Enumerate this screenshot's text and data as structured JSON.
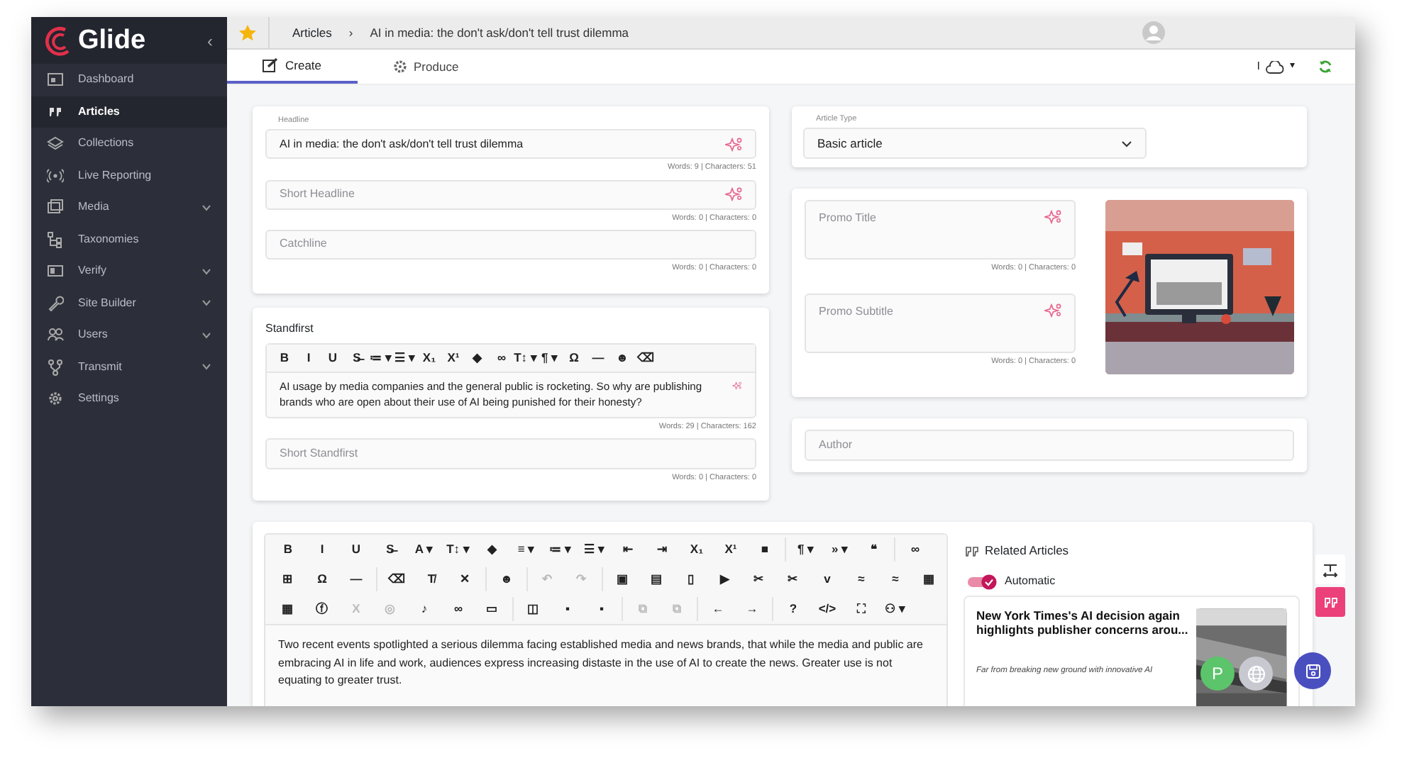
{
  "sidebar": {
    "logo": "Glide",
    "collapse": "‹",
    "items": [
      {
        "label": "Dashboard",
        "selected": false,
        "kind": "link"
      },
      {
        "label": "Articles",
        "selected": true,
        "kind": "link"
      },
      {
        "label": "Collections",
        "selected": false,
        "kind": "link"
      },
      {
        "label": "Live Reporting",
        "selected": false,
        "kind": "link"
      },
      {
        "label": "Media",
        "selected": false,
        "kind": "menu"
      },
      {
        "label": "Taxonomies",
        "selected": false,
        "kind": "link"
      },
      {
        "label": "Verify",
        "selected": false,
        "kind": "menu"
      },
      {
        "label": "Site Builder",
        "selected": false,
        "kind": "menu"
      },
      {
        "label": "Users",
        "selected": false,
        "kind": "menu"
      },
      {
        "label": "Transmit",
        "selected": false,
        "kind": "menu"
      },
      {
        "label": "Settings",
        "selected": false,
        "kind": "link"
      }
    ]
  },
  "breadcrumb": [
    "Articles",
    "AI in media: the don't ask/don't tell trust dilemma"
  ],
  "breadcrumb_separator": "›",
  "tabs": [
    {
      "label": "Create",
      "selected": true
    },
    {
      "label": "Produce",
      "selected": false
    }
  ],
  "status": {
    "cursor": "I",
    "caret": "▾"
  },
  "headline_card": {
    "fields": [
      {
        "label": "Headline",
        "value": "AI in media: the don't ask/don't tell trust dilemma",
        "counter": "Words: 9 | Characters: 51",
        "ai": true
      },
      {
        "placeholder": "Short Headline",
        "counter": "Words: 0 | Characters: 0",
        "ai": true
      },
      {
        "placeholder": "Catchline",
        "counter": "Words: 0 | Characters: 0",
        "ai": false
      }
    ]
  },
  "standfirst_card": {
    "title": "Standfirst",
    "toolbar": [
      "B",
      "I",
      "U",
      "S̶",
      "≔ ▾",
      "☰ ▾",
      "X₁",
      "X¹",
      "◆",
      "∞",
      "T↕ ▾",
      "¶ ▾",
      "Ω",
      "—",
      "☻",
      "⌫"
    ],
    "text": "AI usage by media companies and the general public is rocketing. So why are publishing brands who are open about their use of AI being punished for their honesty?",
    "counter": "Words: 29 | Characters: 162",
    "short": {
      "placeholder": "Short Standfirst",
      "counter": "Words: 0 | Characters: 0"
    }
  },
  "article_type": {
    "label": "Article Type",
    "value": "Basic article"
  },
  "promo": {
    "fields": [
      {
        "placeholder": "Promo Title",
        "counter": "Words: 0 | Characters: 0"
      },
      {
        "placeholder": "Promo Subtitle",
        "counter": "Words: 0 | Characters: 0"
      }
    ]
  },
  "author": {
    "placeholder": "Author"
  },
  "editor": {
    "toolbar": [
      [
        [
          {
            "t": "B",
            "disabled": false
          },
          {
            "t": "I",
            "disabled": false
          },
          {
            "t": "U",
            "disabled": false
          },
          {
            "t": "S̶",
            "disabled": false
          },
          {
            "t": "A ▾",
            "disabled": false
          },
          {
            "t": "T↕ ▾",
            "disabled": false
          },
          {
            "t": "◆",
            "disabled": false
          },
          {
            "t": "≡ ▾",
            "disabled": false
          },
          {
            "t": "≔ ▾",
            "disabled": false
          },
          {
            "t": "☰ ▾",
            "disabled": false
          },
          {
            "t": "⇤",
            "disabled": false
          },
          {
            "t": "⇥",
            "disabled": false
          },
          {
            "t": "X₁",
            "disabled": false
          },
          {
            "t": "X¹",
            "disabled": false
          },
          {
            "t": "■",
            "disabled": false
          }
        ],
        [
          {
            "t": "¶ ▾",
            "disabled": false
          },
          {
            "t": "» ▾",
            "disabled": false
          },
          {
            "t": "❝",
            "disabled": false
          }
        ],
        [
          {
            "t": "∞",
            "disabled": false
          }
        ]
      ],
      [
        [
          {
            "t": "⊞",
            "disabled": false
          },
          {
            "t": "Ω",
            "disabled": false
          },
          {
            "t": "—",
            "disabled": false
          }
        ],
        [
          {
            "t": "⌫",
            "disabled": false
          },
          {
            "t": "T̸",
            "disabled": false
          },
          {
            "t": "✕",
            "disabled": false
          }
        ],
        [
          {
            "t": "☻",
            "disabled": false
          }
        ],
        [
          {
            "t": "↶",
            "disabled": true
          },
          {
            "t": "↷",
            "disabled": true
          }
        ],
        [
          {
            "t": "▣",
            "disabled": false
          },
          {
            "t": "▤",
            "disabled": false
          },
          {
            "t": "▯",
            "disabled": false
          },
          {
            "t": "▶",
            "disabled": false
          },
          {
            "t": "✂",
            "disabled": false
          },
          {
            "t": "✂",
            "disabled": false
          },
          {
            "t": "v",
            "disabled": false
          },
          {
            "t": "≈",
            "disabled": false
          },
          {
            "t": "≈",
            "disabled": false
          },
          {
            "t": "▦",
            "disabled": false
          }
        ]
      ],
      [
        [
          {
            "t": "▦",
            "disabled": false
          },
          {
            "t": "ⓕ",
            "disabled": false
          },
          {
            "t": "X",
            "disabled": true
          },
          {
            "t": "◎",
            "disabled": true
          },
          {
            "t": "♪",
            "disabled": false
          },
          {
            "t": "∞",
            "disabled": false
          },
          {
            "t": "▭",
            "disabled": false
          }
        ],
        [
          {
            "t": "◫",
            "disabled": false
          },
          {
            "t": "▪",
            "disabled": false
          },
          {
            "t": "▪",
            "disabled": false
          }
        ],
        [
          {
            "t": "⧉",
            "disabled": true
          },
          {
            "t": "⧉",
            "disabled": true
          }
        ],
        [
          {
            "t": "←",
            "disabled": false
          },
          {
            "t": "→",
            "disabled": false
          }
        ],
        [
          {
            "t": "?",
            "disabled": false
          },
          {
            "t": "</>",
            "disabled": false
          },
          {
            "t": "⛶",
            "disabled": false
          },
          {
            "t": "⚇ ▾",
            "disabled": false
          }
        ]
      ]
    ],
    "text": "Two recent events spotlighted a serious dilemma facing established media and news brands, that while the media and public are embracing AI in life and work, audiences express increasing distaste in the use of AI to create the news. Greater use is not equating to greater trust."
  },
  "related": {
    "title": "Related Articles",
    "toggle": {
      "label": "Automatic",
      "on": true
    },
    "article": {
      "title": "New York Times's AI decision again highlights publisher concerns arou...",
      "snippet": "Far from breaking new ground with innovative AI"
    }
  },
  "fab": {
    "presence": "P"
  }
}
